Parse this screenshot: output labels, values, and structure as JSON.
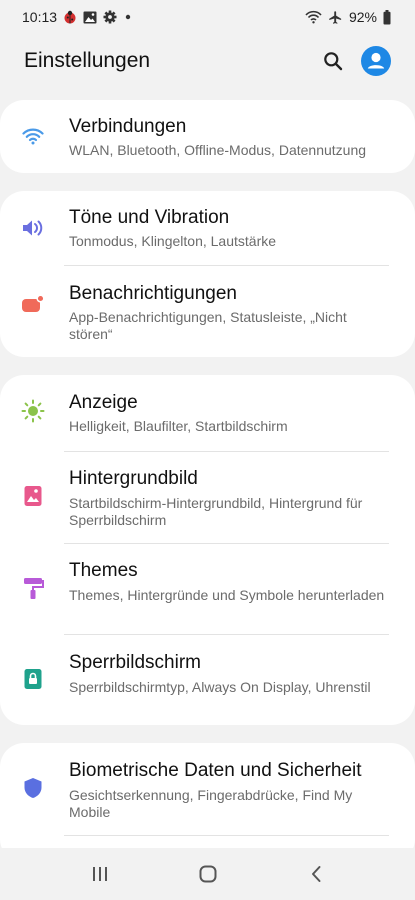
{
  "status_bar": {
    "time": "10:13",
    "battery": "92%",
    "icons_left": [
      "ladybug-icon",
      "gallery-notification-icon",
      "settings-gear-icon",
      "dot-icon"
    ],
    "icons_right": [
      "wifi-icon",
      "airplane-mode-icon",
      "battery-icon"
    ]
  },
  "header": {
    "title": "Einstellungen",
    "search_icon": "search-icon",
    "profile_icon": "account-icon",
    "accent": "#1e88e5"
  },
  "items": [
    {
      "title": "Verbindungen",
      "subtitle": "WLAN, Bluetooth, Offline-Modus, Datennutzung",
      "icon": "wifi-icon",
      "color": "#4a9ae8"
    },
    {
      "title": "Töne und Vibration",
      "subtitle": "Tonmodus, Klingelton, Lautstärke",
      "icon": "volume-icon",
      "color": "#6a6fe0"
    },
    {
      "title": "Benachrichtigungen",
      "subtitle": "App-Benachrichtigungen, Statusleiste, „Nicht stören“",
      "icon": "notification-icon",
      "color": "#f06a5a"
    },
    {
      "title": "Anzeige",
      "subtitle": "Helligkeit, Blaufilter, Startbildschirm",
      "icon": "brightness-icon",
      "color": "#8bc34a"
    },
    {
      "title": "Hintergrundbild",
      "subtitle": "Startbildschirm-Hintergrundbild, Hintergrund für Sperrbildschirm",
      "icon": "wallpaper-icon",
      "color": "#e8588c"
    },
    {
      "title": "Themes",
      "subtitle": "Themes, Hintergründe und Symbole herunterladen",
      "icon": "paint-roller-icon",
      "color": "#b85ad8"
    },
    {
      "title": "Sperrbildschirm",
      "subtitle": "Sperrbildschirmtyp, Always On Display, Uhrenstil",
      "icon": "lock-screen-icon",
      "color": "#1fa28c"
    },
    {
      "title": "Biometrische Daten und Sicherheit",
      "subtitle": "Gesichtserkennung, Fingerabdrücke, Find My Mobile",
      "icon": "shield-icon",
      "color": "#5a6fe0"
    }
  ],
  "nav": [
    "recent-apps-icon",
    "home-icon",
    "back-icon"
  ]
}
